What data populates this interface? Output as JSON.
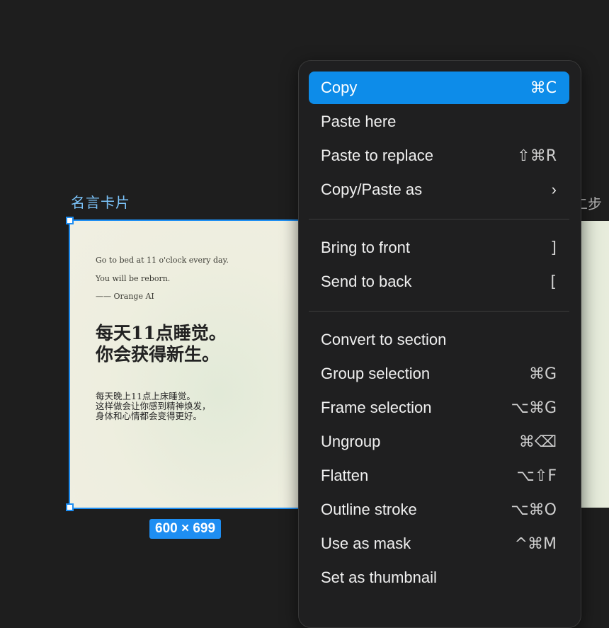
{
  "canvas": {
    "frame_label": "名言卡片",
    "frame2_label": "二步",
    "size_badge": "600 × 699",
    "card": {
      "en_line1": "Go to bed at 11 o'clock every day.",
      "en_line2": "You will be reborn.",
      "en_line3": "—— Orange AI",
      "zh_big_1": "每天11点睡觉。",
      "zh_big_2": "你会获得新生。",
      "zh_small_1": "每天晚上11点上床睡觉。",
      "zh_small_2": "这样做会让你感到精神焕发，",
      "zh_small_3": "身体和心情都会变得更好。"
    }
  },
  "menu": {
    "items": [
      {
        "label": "Copy",
        "shortcut": "⌘C"
      },
      {
        "label": "Paste here",
        "shortcut": ""
      },
      {
        "label": "Paste to replace",
        "shortcut": "⇧⌘R"
      },
      {
        "label": "Copy/Paste as",
        "shortcut": "›"
      },
      {
        "label": "Bring to front",
        "shortcut": "]"
      },
      {
        "label": "Send to back",
        "shortcut": "["
      },
      {
        "label": "Convert to section",
        "shortcut": ""
      },
      {
        "label": "Group selection",
        "shortcut": "⌘G"
      },
      {
        "label": "Frame selection",
        "shortcut": "⌥⌘G"
      },
      {
        "label": "Ungroup",
        "shortcut": "⌘⌫"
      },
      {
        "label": "Flatten",
        "shortcut": "⌥⇧F"
      },
      {
        "label": "Outline stroke",
        "shortcut": "⌥⌘O"
      },
      {
        "label": "Use as mask",
        "shortcut": "^⌘M"
      },
      {
        "label": "Set as thumbnail",
        "shortcut": ""
      }
    ]
  },
  "colors": {
    "accent": "#0d8ce9",
    "selection": "#1e8ef2",
    "background": "#1e1e1e",
    "menu_bg": "#1f1f20"
  }
}
